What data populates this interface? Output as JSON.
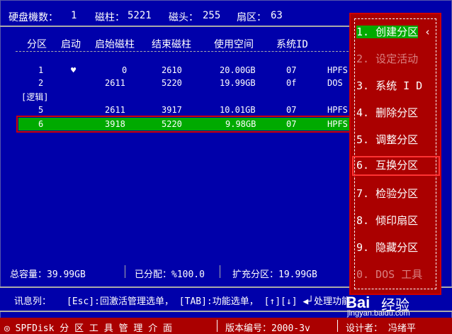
{
  "disk_info": {
    "disk_count_label": "硬盘機数：",
    "disk_count_value": "1",
    "cylinders_label": "磁柱：",
    "cylinders_value": "5221",
    "heads_label": "磁头：",
    "heads_value": "255",
    "sectors_label": "扇区：",
    "sectors_value": "63"
  },
  "table": {
    "headers": [
      "分区",
      "启动",
      "启始磁柱",
      "结束磁柱",
      "使用空间",
      "系统ID"
    ],
    "rows": [
      {
        "part": "1",
        "boot": "♥",
        "start": "0",
        "end": "2610",
        "size": "20.00GB",
        "sysid": "07",
        "fs": "HPFS"
      },
      {
        "part": "2",
        "boot": "",
        "start": "2611",
        "end": "5220",
        "size": "19.99GB",
        "sysid": "0f",
        "fs": "DOS"
      },
      {
        "part": "[逻辑]",
        "boot": "",
        "start": "",
        "end": "",
        "size": "",
        "sysid": "",
        "fs": ""
      },
      {
        "part": "5",
        "boot": "",
        "start": "2611",
        "end": "3917",
        "size": "10.01GB",
        "sysid": "07",
        "fs": "HPFS"
      },
      {
        "part": "6",
        "boot": "",
        "start": "3918",
        "end": "5220",
        "size": "9.98GB",
        "sysid": "07",
        "fs": "HPFS"
      }
    ]
  },
  "totals": {
    "total_label": "总容量：39.99GB",
    "allocated_label": "已分配：%100.0",
    "extended_label": "扩充分区：19.99GB"
  },
  "message": {
    "prefix": "讯息列：",
    "text": "[Esc]:回激活管理选单，   [TAB]:功能选单，   [↑][↓] ◀┘处理功能"
  },
  "status": {
    "app": "◎ SPFDisk 分 区 工 具 管 理 介 面",
    "version": "版本编号：2000-3v",
    "designer": "设计者：  冯绪平"
  },
  "menu": {
    "items": [
      {
        "label": "1. 创建分区"
      },
      {
        "label": "2. 设定活动"
      },
      {
        "label": "3. 系统 I D"
      },
      {
        "label": "4. 删除分区"
      },
      {
        "label": "5. 调整分区"
      },
      {
        "label": "6. 互换分区"
      },
      {
        "label": "7. 检验分区"
      },
      {
        "label": "8. 倾印扇区"
      },
      {
        "label": "9. 隐藏分区"
      },
      {
        "label": "0. DOS 工具"
      }
    ]
  },
  "watermark": {
    "brand": "Bai",
    "brand2": "经验",
    "url": "jingyan.baidu.com"
  },
  "colors": {
    "background": "#0000aa",
    "menu_bg": "#aa0000",
    "selected_row": "#00aa00",
    "highlight_border": "#ff3333"
  }
}
